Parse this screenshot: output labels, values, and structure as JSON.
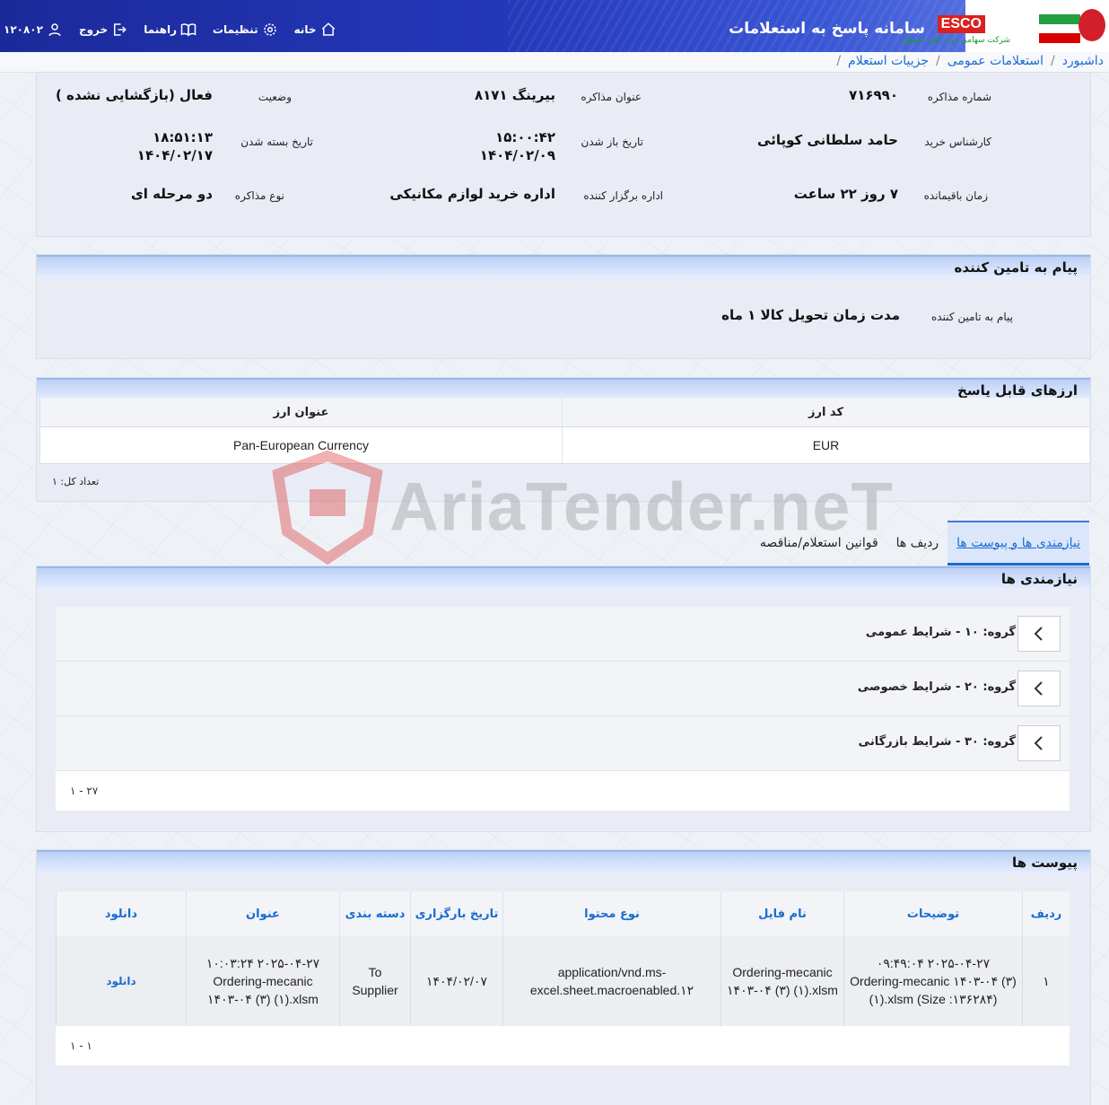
{
  "header": {
    "app_title": "سامانه پاسخ به استعلامات",
    "brand": "ESCO",
    "brand_sub": "شرکت سهامی ذوب آهن اصفهان",
    "nav": {
      "home": "خانه",
      "settings": "تنظیمات",
      "guide": "راهنما",
      "logout": "خروج",
      "user": "۱۲۰۸۰۲"
    }
  },
  "breadcrumb": {
    "dashboard": "داشبورد",
    "general": "استعلامات عمومی",
    "details": "جزییات استعلام",
    "sep": "/"
  },
  "info": {
    "neg_no_label": "شماره مذاکره",
    "neg_no": "۷۱۶۹۹۰",
    "title_label": "عنوان مذاکره",
    "title": "بیرینگ ۸۱۷۱",
    "status_label": "وضعیت",
    "status": "فعال (بازگشایی نشده )",
    "expert_label": "کارشناس خرید",
    "expert": "حامد سلطانی کوپائی",
    "open_label": "تاریخ باز شدن",
    "open": "۱۵:۰۰:۴۲\n۱۴۰۴/۰۲/۰۹",
    "close_label": "تاریخ بسته شدن",
    "close": "۱۸:۵۱:۱۳\n۱۴۰۴/۰۲/۱۷",
    "remain_label": "زمان باقیمانده",
    "remain": "۷ روز ۲۲ ساعت",
    "org_label": "اداره برگزار کننده",
    "org": "اداره خرید لوازم مکانیکی",
    "type_label": "نوع مذاکره",
    "type": "دو مرحله ای"
  },
  "supplier_msg": {
    "title": "پیام به تامین کننده",
    "label": "پیام به تامین کننده",
    "value": "مدت زمان تحویل کالا ۱ ماه"
  },
  "currencies": {
    "title": "ارزهای قابل پاسخ",
    "headers": [
      "کد ارز",
      "عنوان ارز"
    ],
    "rows": [
      [
        "EUR",
        "Pan-European Currency"
      ]
    ],
    "count": "تعداد کل: ۱"
  },
  "tabs": [
    "نیازمندی ها و پیوست ها",
    "ردیف ها",
    "قوانین استعلام/مناقصه"
  ],
  "requirements": {
    "title": "نیازمندی ها",
    "groups": [
      "گروه: ۱۰ - شرایط عمومی",
      "گروه: ۲۰ - شرایط خصوصی",
      "گروه: ۳۰ - شرایط بازرگانی"
    ],
    "pager": "۱ - ۲۷"
  },
  "attachments": {
    "title": "پیوست ها",
    "headers": [
      "ردیف",
      "توضیحات",
      "نام فایل",
      "نوع محتوا",
      "تاریخ بارگزاری",
      "دسته بندی",
      "عنوان",
      "دانلود"
    ],
    "rows": [
      [
        "۱",
        "۲۰۲۵-۰۴-۲۷ ۰۹:۴۹:۰۴ Ordering-mecanic ۱۴۰۳-۰۴ (۳) (۱).xlsm (Size :۱۳۶۲۸۴)",
        "Ordering-mecanic ۱۴۰۳-۰۴ (۳) (۱).xlsm",
        "application/vnd.ms-excel.sheet.macroenabled.۱۲",
        "۱۴۰۴/۰۲/۰۷",
        "To Supplier",
        "۲۰۲۵-۰۴-۲۷ ۱۰:۰۳:۲۴ Ordering-mecanic ۱۴۰۳-۰۴ (۳) (۱).xlsm",
        "دانلود"
      ]
    ],
    "pager": "۱ - ۱"
  },
  "watermark": "AriaTender.neT",
  "colors": {
    "header": "#2437b8",
    "accent": "#1a6cd0",
    "brand_red": "#d9221f"
  }
}
